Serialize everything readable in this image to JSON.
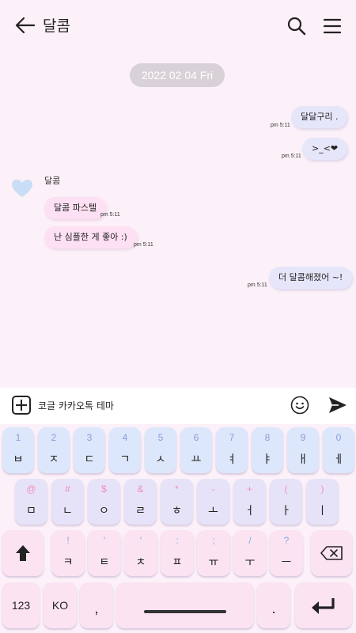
{
  "header": {
    "title": "달콤",
    "icons": {
      "back": "arrow-left-icon",
      "search": "search-icon",
      "menu": "hamburger-menu-icon"
    }
  },
  "chat": {
    "date": "2022 02 04 Fri",
    "sender_name": "달콤",
    "messages": [
      {
        "direction": "out",
        "text": "달달구리 .",
        "time": "pm 5:11"
      },
      {
        "direction": "out",
        "text": ">_<❤",
        "time": "pm 5:11"
      },
      {
        "direction": "in",
        "text": "달콤 파스텔",
        "time": "pm 5:11"
      },
      {
        "direction": "in",
        "text": "난 심플한 게 좋아 :)",
        "time": "pm 5:11"
      },
      {
        "direction": "out",
        "text": "더 달콤해졌어 ~!",
        "time": "pm 5:11"
      }
    ]
  },
  "input_bar": {
    "text": "코글 카카오톡 테마",
    "icons": {
      "add": "plus-square-icon",
      "emoji": "smiley-icon",
      "send": "send-icon"
    }
  },
  "keyboard": {
    "row1": [
      {
        "hint": "1",
        "key": "ㅂ"
      },
      {
        "hint": "2",
        "key": "ㅈ"
      },
      {
        "hint": "3",
        "key": "ㄷ"
      },
      {
        "hint": "4",
        "key": "ㄱ"
      },
      {
        "hint": "5",
        "key": "ㅅ"
      },
      {
        "hint": "6",
        "key": "ㅛ"
      },
      {
        "hint": "7",
        "key": "ㅕ"
      },
      {
        "hint": "8",
        "key": "ㅑ"
      },
      {
        "hint": "9",
        "key": "ㅐ"
      },
      {
        "hint": "0",
        "key": "ㅔ"
      }
    ],
    "row2": [
      {
        "hint": "@",
        "key": "ㅁ"
      },
      {
        "hint": "#",
        "key": "ㄴ"
      },
      {
        "hint": "$",
        "key": "ㅇ"
      },
      {
        "hint": "&",
        "key": "ㄹ"
      },
      {
        "hint": "*",
        "key": "ㅎ"
      },
      {
        "hint": "-",
        "key": "ㅗ"
      },
      {
        "hint": "+",
        "key": "ㅓ"
      },
      {
        "hint": "(",
        "key": "ㅏ"
      },
      {
        "hint": ")",
        "key": "ㅣ"
      }
    ],
    "row3": [
      {
        "hint": "!",
        "key": "ㅋ"
      },
      {
        "hint": "'",
        "key": "ㅌ"
      },
      {
        "hint": "'",
        "key": "ㅊ"
      },
      {
        "hint": ":",
        "key": "ㅍ"
      },
      {
        "hint": ";",
        "key": "ㅠ"
      },
      {
        "hint": "/",
        "key": "ㅜ"
      },
      {
        "hint": "?",
        "key": "ㅡ"
      }
    ],
    "bottom": {
      "num_label": "123",
      "lang_label": "KO",
      "comma_label": ",",
      "period_label": "."
    },
    "icons": {
      "shift": "shift-arrow-icon",
      "backspace": "backspace-icon",
      "enter": "enter-icon",
      "space": "spacebar-icon"
    }
  },
  "colors": {
    "background": "#fcf1f8",
    "bubble_out": "#e6e6fa",
    "bubble_in": "#fde0f3",
    "key_row1": "#dde7fb",
    "key_row2": "#e6e3f8",
    "key_row3": "#fbe3f2",
    "heart": "#c9ddf6"
  }
}
